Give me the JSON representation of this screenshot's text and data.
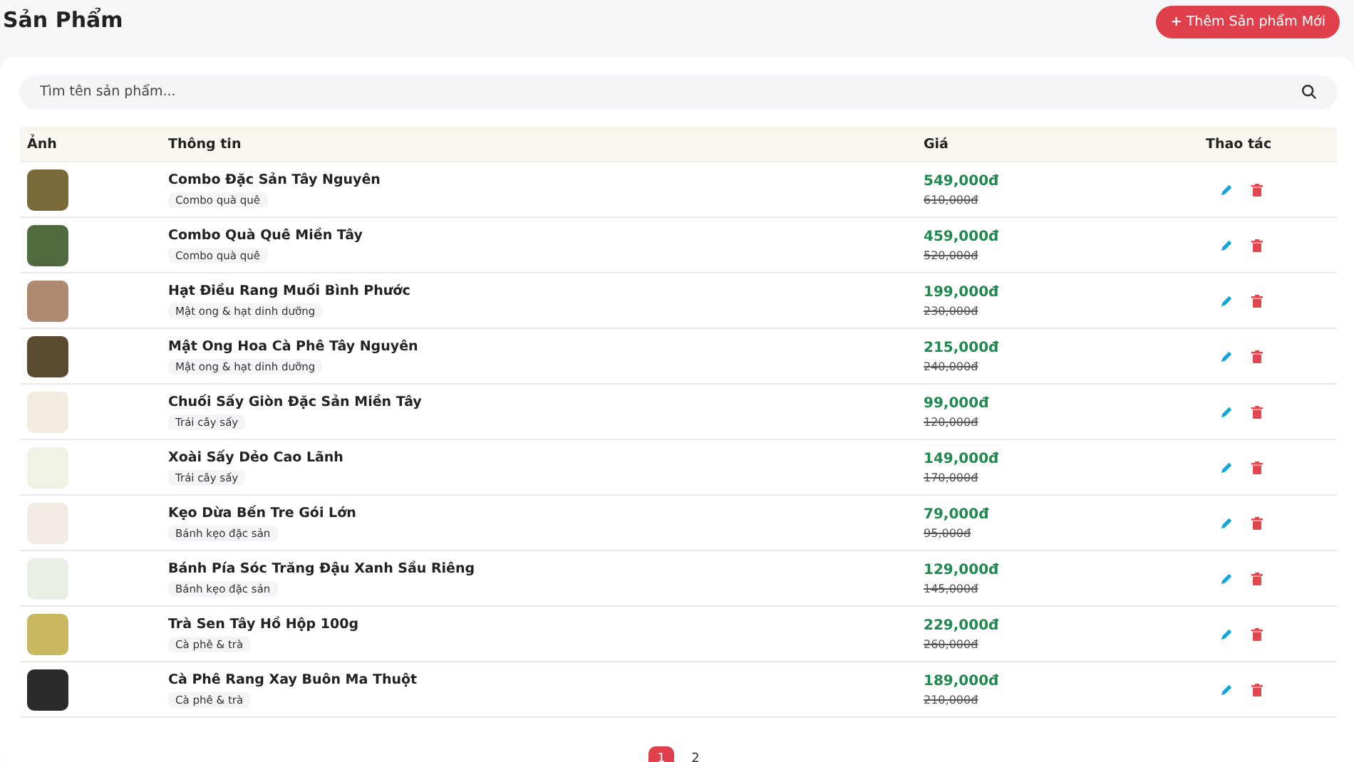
{
  "page_title": "Sản Phẩm",
  "add_button": {
    "icon": "+",
    "label": "Thêm Sản phẩm Mới"
  },
  "search": {
    "placeholder": "Tìm tên sản phẩm..."
  },
  "table": {
    "columns": [
      "Ảnh",
      "Thông tin",
      "Giá",
      "Thao tác"
    ],
    "rows": [
      {
        "name": "Combo Đặc Sản Tây Nguyên",
        "category": "Combo quà quê",
        "price": "549,000đ",
        "old_price": "610,000đ"
      },
      {
        "name": "Combo Quà Quê Miền Tây",
        "category": "Combo quà quê",
        "price": "459,000đ",
        "old_price": "520,000đ"
      },
      {
        "name": "Hạt Điều Rang Muối Bình Phước",
        "category": "Mật ong & hạt dinh dưỡng",
        "price": "199,000đ",
        "old_price": "230,000đ"
      },
      {
        "name": "Mật Ong Hoa Cà Phê Tây Nguyên",
        "category": "Mật ong & hạt dinh dưỡng",
        "price": "215,000đ",
        "old_price": "240,000đ"
      },
      {
        "name": "Chuối Sấy Giòn Đặc Sản Miền Tây",
        "category": "Trái cây sấy",
        "price": "99,000đ",
        "old_price": "120,000đ"
      },
      {
        "name": "Xoài Sấy Dẻo Cao Lãnh",
        "category": "Trái cây sấy",
        "price": "149,000đ",
        "old_price": "170,000đ"
      },
      {
        "name": "Kẹo Dừa Bến Tre Gói Lớn",
        "category": "Bánh kẹo đặc sản",
        "price": "79,000đ",
        "old_price": "95,000đ"
      },
      {
        "name": "Bánh Pía Sóc Trăng Đậu Xanh Sầu Riêng",
        "category": "Bánh kẹo đặc sản",
        "price": "129,000đ",
        "old_price": "145,000đ"
      },
      {
        "name": "Trà Sen Tây Hồ Hộp 100g",
        "category": "Cà phê & trà",
        "price": "229,000đ",
        "old_price": "260,000đ"
      },
      {
        "name": "Cà Phê Rang Xay Buôn Ma Thuột",
        "category": "Cà phê & trà",
        "price": "189,000đ",
        "old_price": "210,000đ"
      }
    ]
  },
  "pagination": [
    {
      "label": "1",
      "selected": true
    },
    {
      "label": "2",
      "selected": false
    }
  ]
}
